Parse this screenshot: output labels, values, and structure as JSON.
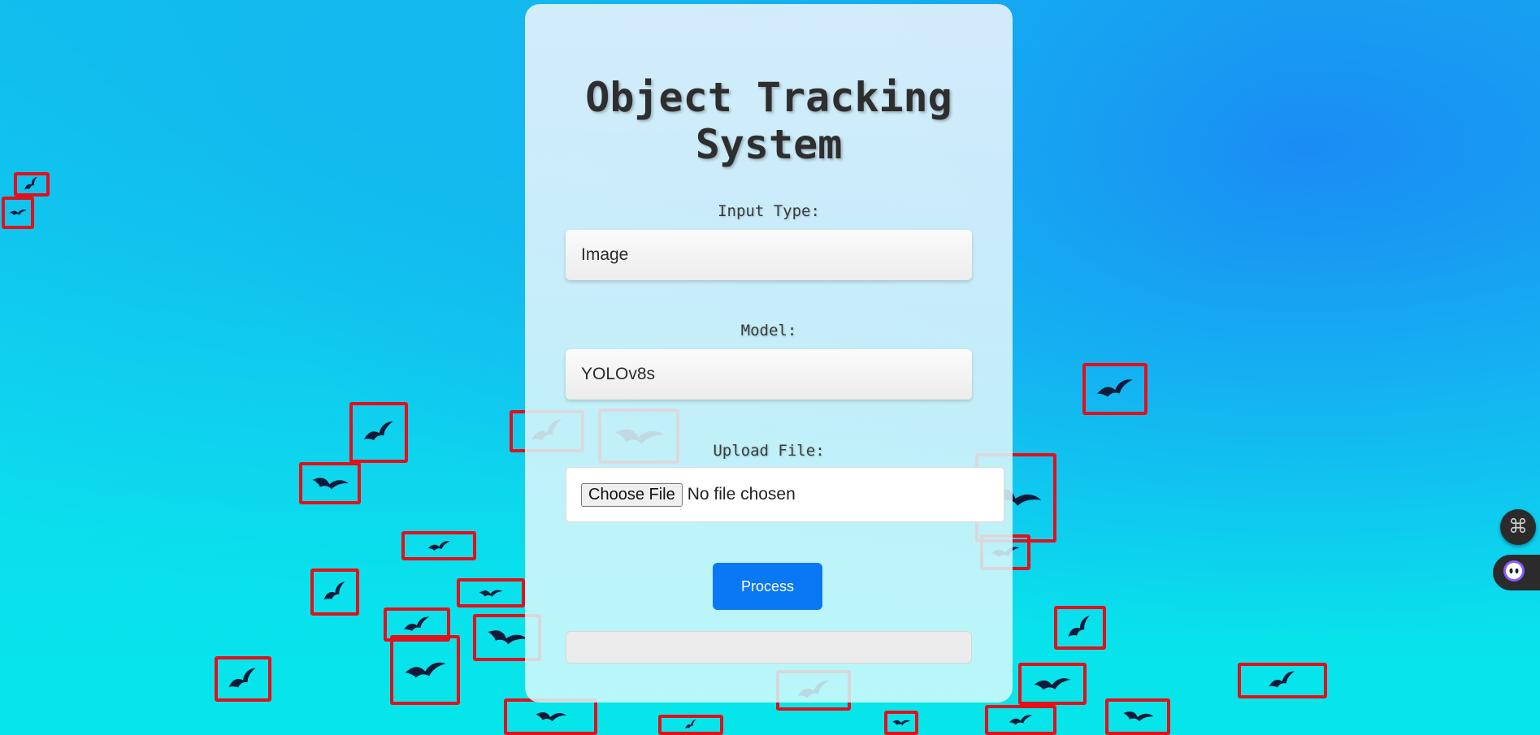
{
  "app": {
    "title": "Object Tracking System"
  },
  "form": {
    "input_type_label": "Input Type:",
    "input_type_value": "Image",
    "model_label": "Model:",
    "model_value": "YOLOv8s",
    "upload_label": "Upload File:",
    "choose_file_label": "Choose File",
    "no_file_text": "No file chosen",
    "process_label": "Process"
  },
  "floating": {
    "command_icon": "command-key-icon",
    "assistant_icon": "assistant-face-icon"
  },
  "colors": {
    "accent": "#0a78f5",
    "bbox": "#e2101a",
    "background_top": "#10c4ef",
    "background_bottom": "#06e6ea"
  }
}
